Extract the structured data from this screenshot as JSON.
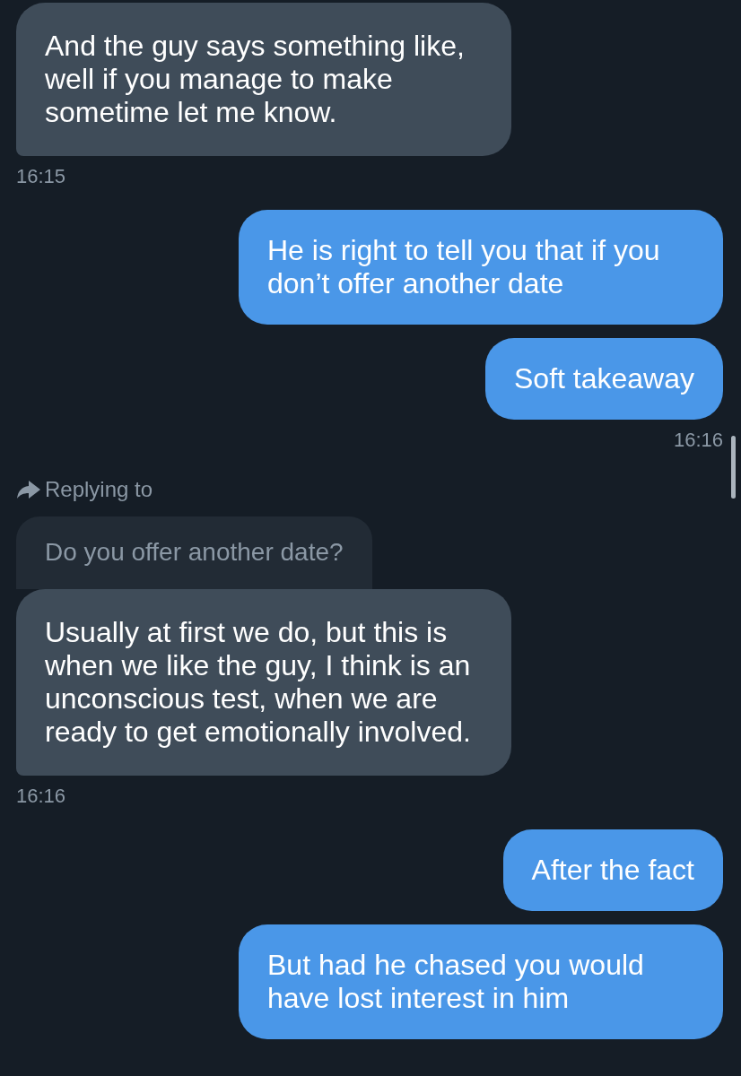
{
  "messages": [
    {
      "kind": "incoming",
      "text": "And the guy says something like, well if you manage to make sometime let me know."
    },
    {
      "kind": "incoming_time",
      "text": "16:15"
    },
    {
      "kind": "outgoing",
      "text": "He is right to tell you that if you don’t offer another date"
    },
    {
      "kind": "outgoing",
      "text": "Soft takeaway"
    },
    {
      "kind": "outgoing_time",
      "text": "16:16"
    },
    {
      "kind": "reply",
      "label": "Replying to",
      "quote": "Do you offer another date?"
    },
    {
      "kind": "incoming",
      "text": "Usually at first we do, but this is when we like the guy, I think is an unconscious test, when we are ready to get emotionally involved."
    },
    {
      "kind": "incoming_time",
      "text": "16:16"
    },
    {
      "kind": "outgoing",
      "text": "After the fact"
    },
    {
      "kind": "outgoing",
      "text": "But had he chased you would have lost interest in him"
    }
  ]
}
